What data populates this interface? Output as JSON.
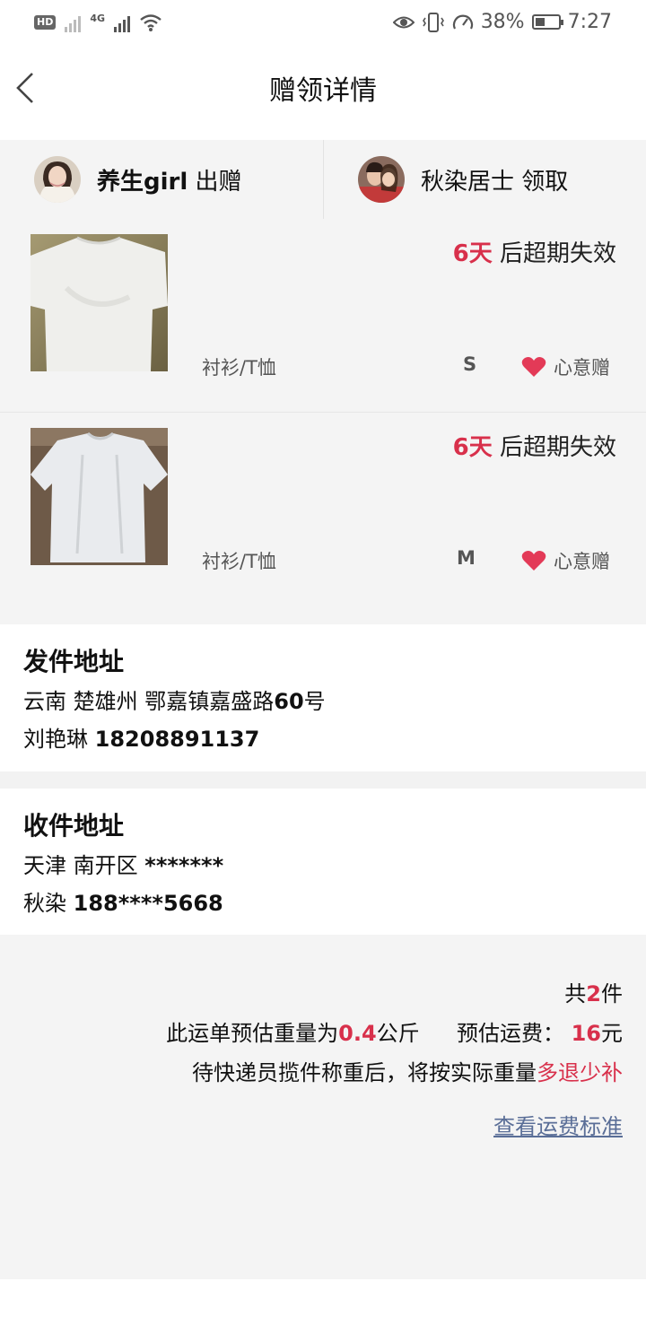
{
  "status_bar": {
    "hd_badge": "HD",
    "network_label": "4G",
    "battery_percent": "38%",
    "battery_level": 0.38,
    "time": "7:27"
  },
  "header": {
    "back_icon": "chevron-left-icon",
    "title": "赠领详情"
  },
  "users": {
    "giver": {
      "name": "养生girl",
      "action": "出赠"
    },
    "receiver": {
      "name": "秋染居士",
      "action": "领取"
    }
  },
  "items": [
    {
      "expire_days": "6天",
      "expire_suffix": " 后超期失效",
      "category": "衬衫/T恤",
      "size": "S",
      "gift_label": "心意赠"
    },
    {
      "expire_days": "6天",
      "expire_suffix": " 后超期失效",
      "category": "衬衫/T恤",
      "size": "M",
      "gift_label": "心意赠"
    }
  ],
  "sender_address": {
    "title": "发件地址",
    "address": "云南 楚雄州 鄂嘉镇嘉盛路",
    "address_number": "60",
    "address_suffix": "号",
    "name": "刘艳琳",
    "phone": "18208891137"
  },
  "receiver_address": {
    "title": "收件地址",
    "address": "天津 南开区",
    "address_masked": "*******",
    "name": "秋染",
    "phone": "188****5668"
  },
  "summary": {
    "total_prefix": "共",
    "total_count": "2",
    "total_suffix": "件",
    "weight_prefix": "此运单预估重量为",
    "weight_value": "0.4",
    "weight_unit": "公斤",
    "fee_label": "预估运费：",
    "fee_value": "16",
    "fee_unit": "元",
    "note_prefix": "待快递员揽件称重后，将按实际重量",
    "note_highlight": "多退少补",
    "link": "查看运费标准"
  },
  "colors": {
    "accent": "#d8304b",
    "link": "#5a6e97",
    "background": "#f4f4f4"
  }
}
